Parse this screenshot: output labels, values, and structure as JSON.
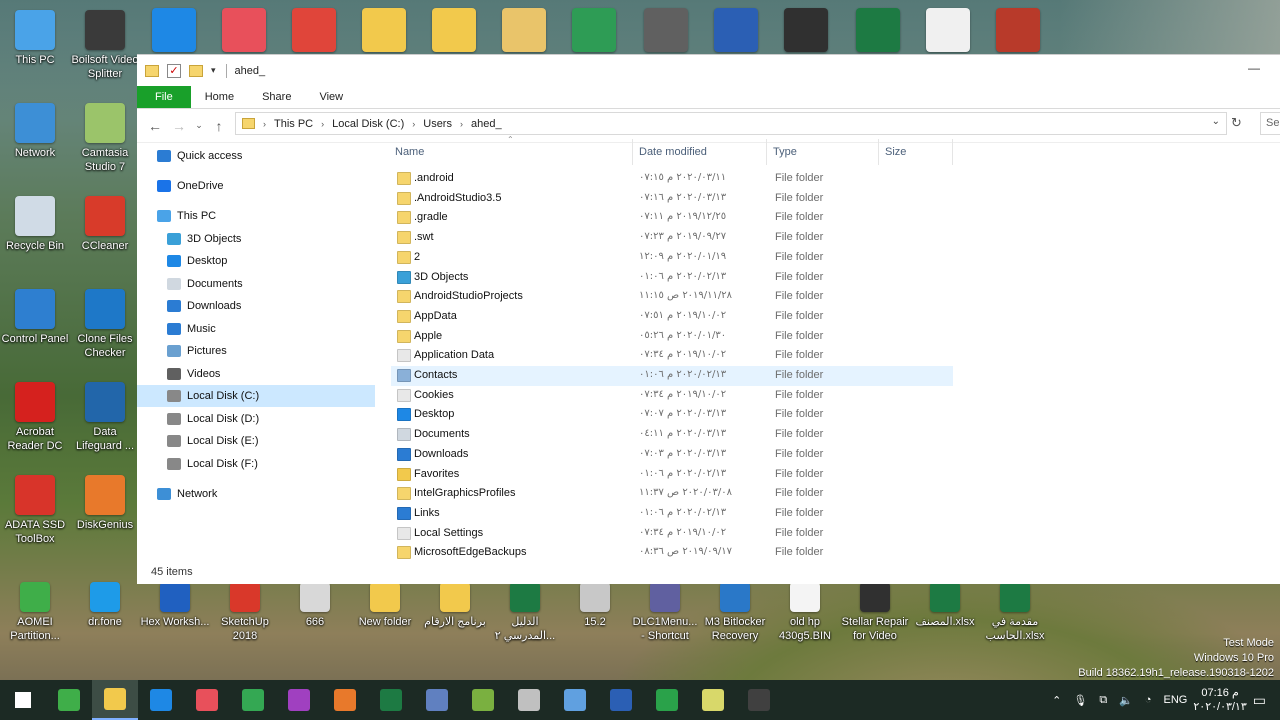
{
  "desktop_left": [
    {
      "label": "This PC",
      "color": "#4aa3e8"
    },
    {
      "label": "Boilsoft Video Splitter",
      "color": "#3a3a3a"
    },
    {
      "label": "Network",
      "color": "#3d8fd6"
    },
    {
      "label": "Camtasia Studio 7",
      "color": "#9bc46a"
    },
    {
      "label": "Recycle Bin",
      "color": "#d0dbe6"
    },
    {
      "label": "CCleaner",
      "color": "#d83b2a"
    },
    {
      "label": "Control Panel",
      "color": "#2e7fd0"
    },
    {
      "label": "Clone Files Checker",
      "color": "#1e78c8"
    },
    {
      "label": "Acrobat Reader DC",
      "color": "#d5211e"
    },
    {
      "label": "Data Lifeguard ...",
      "color": "#2266aa"
    },
    {
      "label": "ADATA SSD ToolBox",
      "color": "#d8342a"
    },
    {
      "label": "DiskGenius",
      "color": "#e8792b"
    }
  ],
  "desktop_bottom": [
    {
      "label": "AOMEI Partition...",
      "color": "#3fae49"
    },
    {
      "label": "dr.fone",
      "color": "#1e9be8"
    },
    {
      "label": "Hex Worksh...",
      "color": "#2060c0"
    },
    {
      "label": "SketchUp 2018",
      "color": "#d9382a"
    },
    {
      "label": "666",
      "color": "#d8d8d8"
    },
    {
      "label": "New folder",
      "color": "#f2c94c"
    },
    {
      "label": "برنامج الارقام",
      "color": "#f2c94c"
    },
    {
      "label": "الدليل المدرسي ٢...",
      "color": "#1d7a43"
    },
    {
      "label": "15.2",
      "color": "#c8c8c8"
    },
    {
      "label": "DLC1Menu... - Shortcut",
      "color": "#6060a0"
    },
    {
      "label": "M3 Bitlocker Recovery",
      "color": "#2a78c8"
    },
    {
      "label": "old hp 430g5.BIN",
      "color": "#f4f4f4"
    },
    {
      "label": "Stellar Repair for Video",
      "color": "#303030"
    },
    {
      "label": "المصنف.xlsx",
      "color": "#1d7a43"
    },
    {
      "label": "مقدمة في الحاسب.xlsx",
      "color": "#1d7a43"
    }
  ],
  "desktop_top_colors": [
    "#1e88e5",
    "#e8505b",
    "#e0453a",
    "#f2c94c",
    "#f2c94c",
    "#e9c46a",
    "#2e9c55",
    "#606060",
    "#2b5fb4",
    "#303030",
    "#1d7a43",
    "#f0f0f0",
    "#b83a2a"
  ],
  "window": {
    "title": "ahed_",
    "ribbon_tabs": [
      "File",
      "Home",
      "Share",
      "View"
    ],
    "breadcrumb": [
      "This PC",
      "Local Disk (C:)",
      "Users",
      "ahed_"
    ],
    "search_placeholder": "Se",
    "status": "45 items",
    "columns": {
      "name": "Name",
      "date": "Date modified",
      "type": "Type",
      "size": "Size"
    }
  },
  "nav": [
    {
      "label": "Quick access",
      "icon": "star-icon",
      "color": "#2b7cd3"
    },
    {
      "label": "OneDrive",
      "icon": "cloud-icon",
      "color": "#1a73e8"
    },
    {
      "label": "This PC",
      "icon": "computer-icon",
      "color": "#4aa3e8"
    },
    {
      "label": "3D Objects",
      "icon": "cube-icon",
      "color": "#3aa0d8"
    },
    {
      "label": "Desktop",
      "icon": "desktop-icon",
      "color": "#1e88e5"
    },
    {
      "label": "Documents",
      "icon": "document-icon",
      "color": "#d0d8e0"
    },
    {
      "label": "Downloads",
      "icon": "download-icon",
      "color": "#2b7cd3"
    },
    {
      "label": "Music",
      "icon": "music-icon",
      "color": "#2b7cd3"
    },
    {
      "label": "Pictures",
      "icon": "pictures-icon",
      "color": "#6aa0d0"
    },
    {
      "label": "Videos",
      "icon": "video-icon",
      "color": "#606060"
    },
    {
      "label": "Local Disk (C:)",
      "icon": "drive-icon",
      "color": "#888"
    },
    {
      "label": "Local Disk (D:)",
      "icon": "drive-icon",
      "color": "#888"
    },
    {
      "label": "Local Disk (E:)",
      "icon": "drive-icon",
      "color": "#888"
    },
    {
      "label": "Local Disk (F:)",
      "icon": "drive-icon",
      "color": "#888"
    },
    {
      "label": "Network",
      "icon": "network-icon",
      "color": "#3d8fd6"
    }
  ],
  "files": [
    {
      "name": ".android",
      "date": "٢٠٢٠/٠٣/١١ م ٠٧:١٥",
      "type": "File folder",
      "color": "#f6d56d"
    },
    {
      "name": ".AndroidStudio3.5",
      "date": "٢٠٢٠/٠٣/١٣ م ٠٧:١٦",
      "type": "File folder",
      "color": "#f6d56d"
    },
    {
      "name": ".gradle",
      "date": "٢٠١٩/١٢/٢٥ م ٠٧:١١",
      "type": "File folder",
      "color": "#f6d56d"
    },
    {
      "name": ".swt",
      "date": "٢٠١٩/٠٩/٢٧ م ٠٧:٢٣",
      "type": "File folder",
      "color": "#f6d56d"
    },
    {
      "name": "2",
      "date": "٢٠٢٠/٠١/١٩ م ١٢:٠٩",
      "type": "File folder",
      "color": "#f6d56d"
    },
    {
      "name": "3D Objects",
      "date": "٢٠٢٠/٠٢/١٣ م ٠١:٠٦",
      "type": "File folder",
      "color": "#3aa0d8"
    },
    {
      "name": "AndroidStudioProjects",
      "date": "٢٠١٩/١١/٢٨ ص ١١:١٥",
      "type": "File folder",
      "color": "#f6d56d"
    },
    {
      "name": "AppData",
      "date": "٢٠١٩/١٠/٠٢ م ٠٧:٥١",
      "type": "File folder",
      "color": "#f6d56d"
    },
    {
      "name": "Apple",
      "date": "٢٠٢٠/٠١/٣٠ م ٠٥:٢٦",
      "type": "File folder",
      "color": "#f6d56d"
    },
    {
      "name": "Application Data",
      "date": "٢٠١٩/١٠/٠٢ م ٠٧:٣٤",
      "type": "File folder",
      "color": "#e8e8e8"
    },
    {
      "name": "Contacts",
      "date": "٢٠٢٠/٠٢/١٣ م ٠١:٠٦",
      "type": "File folder",
      "color": "#8ab0d8"
    },
    {
      "name": "Cookies",
      "date": "٢٠١٩/١٠/٠٢ م ٠٧:٣٤",
      "type": "File folder",
      "color": "#e8e8e8"
    },
    {
      "name": "Desktop",
      "date": "٢٠٢٠/٠٣/١٣ م ٠٧:٠٧",
      "type": "File folder",
      "color": "#1e88e5"
    },
    {
      "name": "Documents",
      "date": "٢٠٢٠/٠٣/١٣ م ٠٤:١١",
      "type": "File folder",
      "color": "#d0d8e0"
    },
    {
      "name": "Downloads",
      "date": "٢٠٢٠/٠٣/١٣ م ٠٧:٠٣",
      "type": "File folder",
      "color": "#2b7cd3"
    },
    {
      "name": "Favorites",
      "date": "٢٠٢٠/٠٢/١٣ م ٠١:٠٦",
      "type": "File folder",
      "color": "#f2c94c"
    },
    {
      "name": "IntelGraphicsProfiles",
      "date": "٢٠٢٠/٠٣/٠٨ ص ١١:٣٧",
      "type": "File folder",
      "color": "#f6d56d"
    },
    {
      "name": "Links",
      "date": "٢٠٢٠/٠٢/١٣ م ٠١:٠٦",
      "type": "File folder",
      "color": "#2b7cd3"
    },
    {
      "name": "Local Settings",
      "date": "٢٠١٩/١٠/٠٢ م ٠٧:٣٤",
      "type": "File folder",
      "color": "#e8e8e8"
    },
    {
      "name": "MicrosoftEdgeBackups",
      "date": "٢٠١٩/٠٩/١٧ ص ٠٨:٣٦",
      "type": "File folder",
      "color": "#f6d56d"
    }
  ],
  "taskbar_colors": [
    "#ffffff",
    "#3fae49",
    "#f2c94c",
    "#1e88e5",
    "#e8505b",
    "#34a853",
    "#a040c0",
    "#e8792b",
    "#1d7a43",
    "#6080c0",
    "#7ab040",
    "#c0c0c0",
    "#60a0e0",
    "#2b5fb4",
    "#2aa24a",
    "#d8d86a",
    "#404040"
  ],
  "tray": {
    "lang": "ENG",
    "time": "07:16 م",
    "date": "٢٠٢٠/٠٣/١٣"
  },
  "watermark": [
    "Test Mode",
    "Windows 10 Pro",
    "Build 18362.19h1_release.190318-1202"
  ]
}
